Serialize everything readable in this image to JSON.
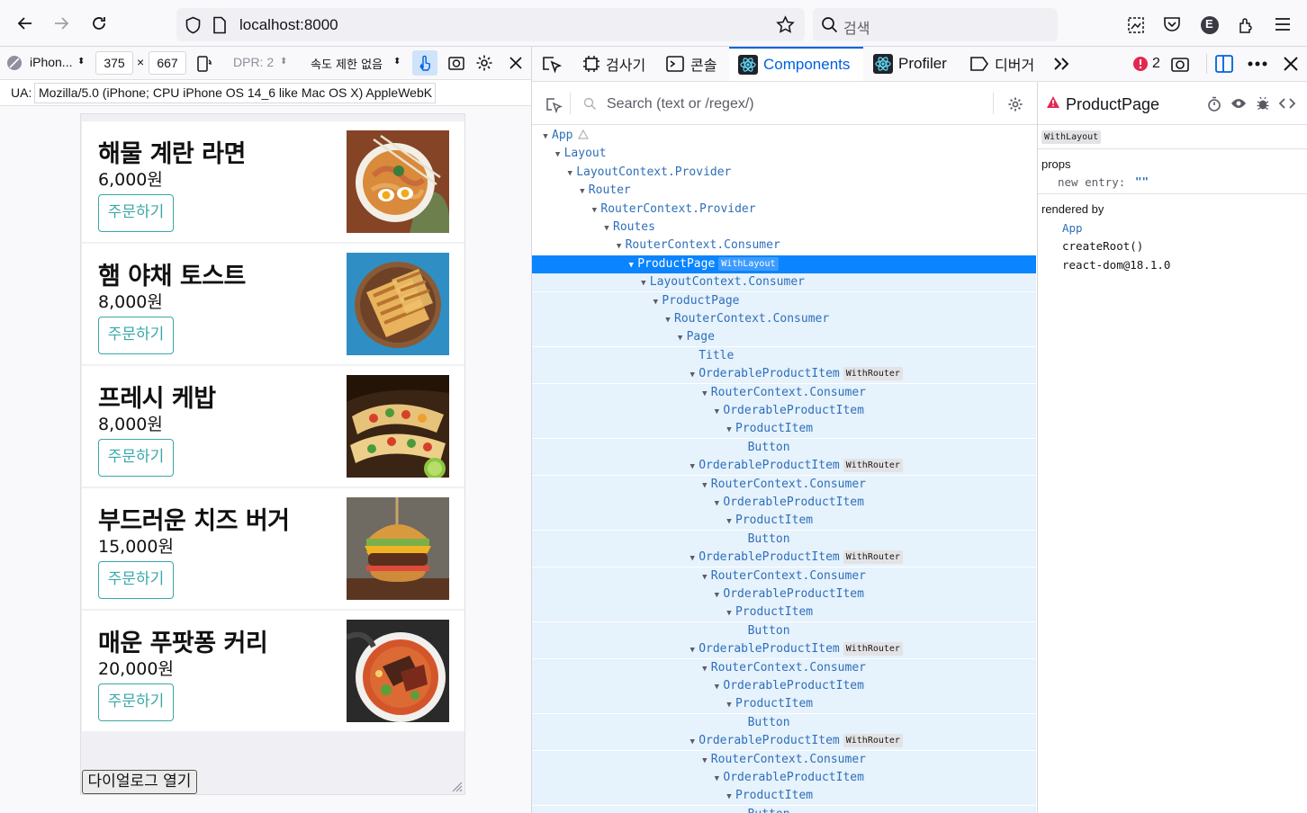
{
  "browser": {
    "url": "localhost:8000",
    "search_placeholder": "검색",
    "profile_letter": "E"
  },
  "rdm": {
    "device": "iPhon...",
    "width": "375",
    "times": "×",
    "height": "667",
    "dpr": "DPR: 2",
    "throttle": "속도 제한 없음",
    "ua_label": "UA:",
    "ua_value": "Mozilla/5.0 (iPhone; CPU iPhone OS 14_6 like Mac OS X) AppleWebK"
  },
  "products": [
    {
      "name": "해물 계란 라면",
      "price": "6,000원",
      "button": "주문하기",
      "image": "ramen-bowl"
    },
    {
      "name": "햄 야채 토스트",
      "price": "8,000원",
      "button": "주문하기",
      "image": "toast-plate"
    },
    {
      "name": "프레시 케밥",
      "price": "8,000원",
      "button": "주문하기",
      "image": "kebab-tacos"
    },
    {
      "name": "부드러운 치즈 버거",
      "price": "15,000원",
      "button": "주문하기",
      "image": "cheese-burger"
    },
    {
      "name": "매운 푸팟퐁 커리",
      "price": "20,000원",
      "button": "주문하기",
      "image": "curry-bowl"
    }
  ],
  "dialog_button": "다이얼로그 열기",
  "devtools": {
    "tabs": {
      "inspector": "검사기",
      "console": "콘솔",
      "components": "Components",
      "profiler": "Profiler",
      "debugger": "디버거"
    },
    "error_count": "2",
    "search_placeholder": "Search (text or /regex/)"
  },
  "tree": [
    {
      "name": "App",
      "depth": 0,
      "caret": true,
      "warn": true
    },
    {
      "name": "Layout",
      "depth": 1,
      "caret": true
    },
    {
      "name": "LayoutContext.Provider",
      "depth": 2,
      "caret": true
    },
    {
      "name": "Router",
      "depth": 3,
      "caret": true
    },
    {
      "name": "RouterContext.Provider",
      "depth": 4,
      "caret": true
    },
    {
      "name": "Routes",
      "depth": 5,
      "caret": true
    },
    {
      "name": "RouterContext.Consumer",
      "depth": 6,
      "caret": true
    },
    {
      "name": "ProductPage",
      "depth": 7,
      "caret": true,
      "hoc": "WithLayout",
      "selected": true
    },
    {
      "name": "LayoutContext.Consumer",
      "depth": 8,
      "caret": true
    },
    {
      "name": "ProductPage",
      "depth": 9,
      "caret": true
    },
    {
      "name": "RouterContext.Consumer",
      "depth": 10,
      "caret": true
    },
    {
      "name": "Page",
      "depth": 11,
      "caret": true
    },
    {
      "name": "Title",
      "depth": 12,
      "caret": false
    },
    {
      "name": "OrderableProductItem",
      "depth": 12,
      "caret": true,
      "hoc": "WithRouter"
    },
    {
      "name": "RouterContext.Consumer",
      "depth": 13,
      "caret": true
    },
    {
      "name": "OrderableProductItem",
      "depth": 14,
      "caret": true
    },
    {
      "name": "ProductItem",
      "depth": 15,
      "caret": true
    },
    {
      "name": "Button",
      "depth": 16,
      "caret": false
    },
    {
      "name": "OrderableProductItem",
      "depth": 12,
      "caret": true,
      "hoc": "WithRouter"
    },
    {
      "name": "RouterContext.Consumer",
      "depth": 13,
      "caret": true
    },
    {
      "name": "OrderableProductItem",
      "depth": 14,
      "caret": true
    },
    {
      "name": "ProductItem",
      "depth": 15,
      "caret": true
    },
    {
      "name": "Button",
      "depth": 16,
      "caret": false
    },
    {
      "name": "OrderableProductItem",
      "depth": 12,
      "caret": true,
      "hoc": "WithRouter"
    },
    {
      "name": "RouterContext.Consumer",
      "depth": 13,
      "caret": true
    },
    {
      "name": "OrderableProductItem",
      "depth": 14,
      "caret": true
    },
    {
      "name": "ProductItem",
      "depth": 15,
      "caret": true
    },
    {
      "name": "Button",
      "depth": 16,
      "caret": false
    },
    {
      "name": "OrderableProductItem",
      "depth": 12,
      "caret": true,
      "hoc": "WithRouter"
    },
    {
      "name": "RouterContext.Consumer",
      "depth": 13,
      "caret": true
    },
    {
      "name": "OrderableProductItem",
      "depth": 14,
      "caret": true
    },
    {
      "name": "ProductItem",
      "depth": 15,
      "caret": true
    },
    {
      "name": "Button",
      "depth": 16,
      "caret": false
    },
    {
      "name": "OrderableProductItem",
      "depth": 12,
      "caret": true,
      "hoc": "WithRouter"
    },
    {
      "name": "RouterContext.Consumer",
      "depth": 13,
      "caret": true
    },
    {
      "name": "OrderableProductItem",
      "depth": 14,
      "caret": true
    },
    {
      "name": "ProductItem",
      "depth": 15,
      "caret": true
    },
    {
      "name": "Button",
      "depth": 16,
      "caret": false
    }
  ],
  "inspected": {
    "title": "ProductPage",
    "hoc": "WithLayout",
    "props_label": "props",
    "prop_key": "new entry:",
    "prop_value": "\"\"",
    "rendered_by_label": "rendered by",
    "rendered_by": [
      "App",
      "createRoot()",
      "react-dom@18.1.0"
    ]
  },
  "colors": {
    "accent": "#0061e0",
    "selection": "#0a84ff",
    "selection_subtree": "#e6f2fc",
    "order_button": "#3aa8a8",
    "error": "#e22850"
  }
}
